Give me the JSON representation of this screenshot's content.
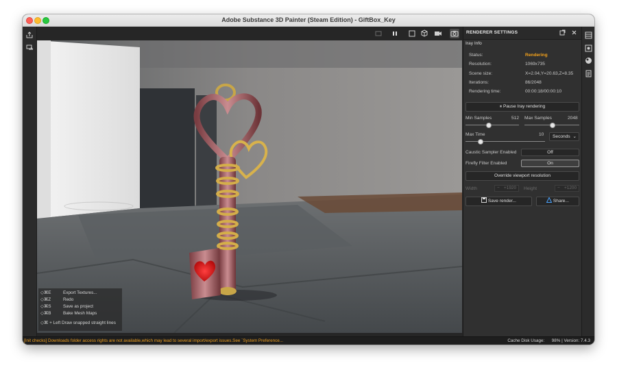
{
  "window": {
    "title": "Adobe Substance 3D Painter (Steam Edition) - GiftBox_Key"
  },
  "left_toolbar": {
    "icons": [
      "export-icon",
      "bake-icon"
    ]
  },
  "viewport_toolbar": {
    "icons": [
      "solo-icon",
      "pause-icon",
      "frame-icon",
      "cube-icon",
      "camera-video-icon",
      "screenshot-icon"
    ]
  },
  "shortcuts": [
    {
      "keys": "◇⌘E",
      "action": "Export Textures..."
    },
    {
      "keys": "◇⌘Z",
      "action": "Redo"
    },
    {
      "keys": "◇⌘S",
      "action": "Save as project"
    },
    {
      "keys": "◇⌘B",
      "action": "Bake Mesh Maps"
    },
    {
      "keys": "◇⌘ + Left",
      "action": "Draw snapped straight lines"
    }
  ],
  "panel": {
    "title": "RENDERER SETTINGS",
    "section": "Iray Info",
    "info": [
      {
        "label": "Status:",
        "value": "Rendering"
      },
      {
        "label": "Resolution:",
        "value": "1069x735"
      },
      {
        "label": "Scene size:",
        "value": "X=2.04,Y=20.63,Z=8.35"
      },
      {
        "label": "Iterations:",
        "value": "86/2048"
      },
      {
        "label": "Rendering time:",
        "value": "00:00:18/00:00:10"
      }
    ],
    "pause_label": "Pause Iray rendering",
    "min_samples": {
      "label": "Min Samples",
      "value": "512",
      "fraction": 0.43
    },
    "max_samples": {
      "label": "Max Samples",
      "value": "2048",
      "fraction": 0.52
    },
    "max_time": {
      "label": "Max Time",
      "value": "10",
      "unit": "Seconds",
      "fraction": 0.17
    },
    "caustic": {
      "label": "Caustic Sampler Enabled",
      "value": "Off"
    },
    "firefly": {
      "label": "Firefly Filter Enabled",
      "value": "On"
    },
    "override_label": "Override viewport resolution",
    "width": {
      "label": "Width",
      "value": "1920"
    },
    "height": {
      "label": "Height",
      "value": "1200"
    },
    "save_label": "Save render...",
    "share_label": "Share..."
  },
  "right_toolbar": {
    "icons": [
      "layers-icon",
      "display-settings-icon",
      "renderer-icon",
      "notes-icon"
    ]
  },
  "status": {
    "warning": "[Init checks] Downloads folder access rights are not available,which may lead to several import/export issues.See `System Preference...",
    "cache_label": "Cache Disk Usage:",
    "cache_value": "98%",
    "version": "| Version: 7.4.3"
  },
  "colors": {
    "accent_status": "#f4a21b",
    "panel_bg": "#303030",
    "warning": "#f0a020"
  }
}
